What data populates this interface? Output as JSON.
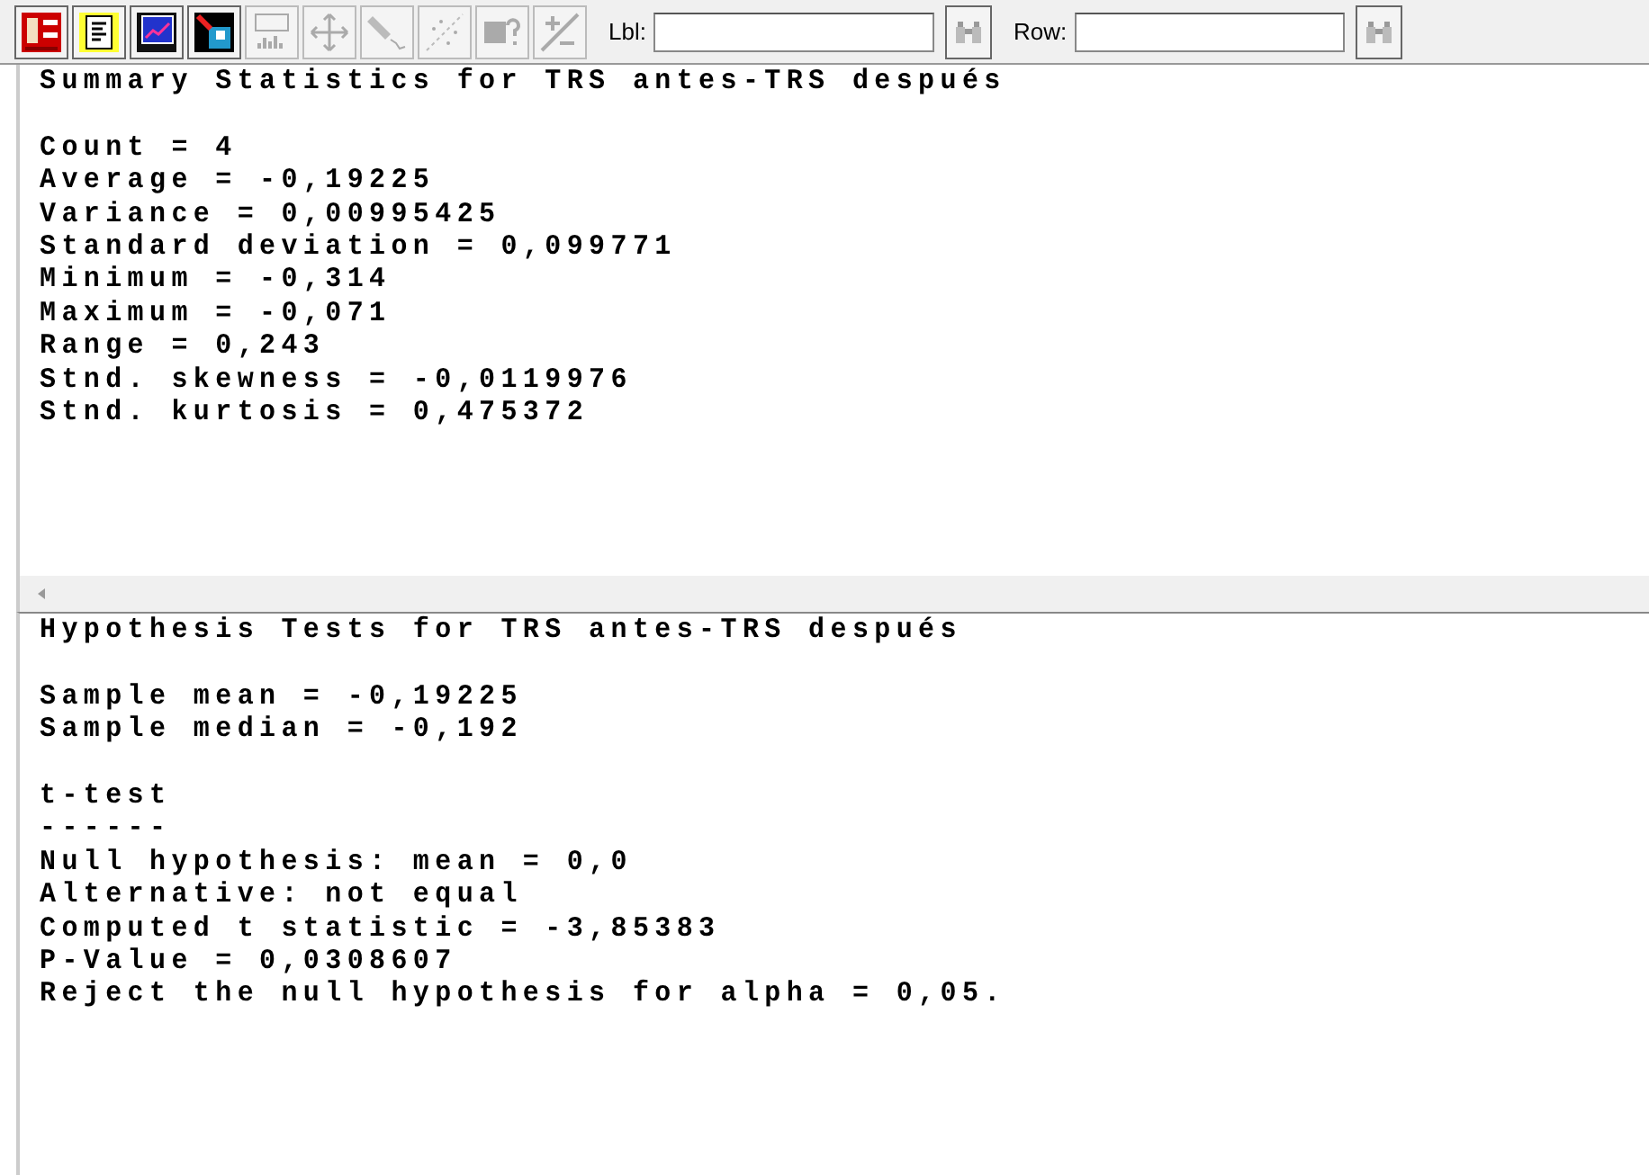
{
  "toolbar": {
    "buttons": [
      {
        "kind": "table",
        "disabled": false
      },
      {
        "kind": "text",
        "disabled": false
      },
      {
        "kind": "graph",
        "disabled": false
      },
      {
        "kind": "save",
        "disabled": false
      },
      {
        "kind": "labels",
        "disabled": true
      },
      {
        "kind": "move",
        "disabled": true
      },
      {
        "kind": "brush",
        "disabled": true
      },
      {
        "kind": "scatter",
        "disabled": true
      },
      {
        "kind": "help",
        "disabled": true
      },
      {
        "kind": "plusminus",
        "disabled": true
      }
    ],
    "label_search": {
      "label": "Lbl:"
    },
    "row_search": {
      "label": "Row:"
    }
  },
  "panes": [
    {
      "blocks": [
        [
          "Summary Statistics for TRS antes-TRS después"
        ],
        [
          "Count = 4",
          "Average = -0,19225",
          "Variance = 0,00995425",
          "Standard deviation = 0,099771",
          "Minimum = -0,314",
          "Maximum = -0,071",
          "Range = 0,243",
          "Stnd. skewness = -0,0119976",
          "Stnd. kurtosis = 0,475372"
        ]
      ]
    },
    {
      "blocks": [
        [
          "Hypothesis Tests for TRS antes-TRS después"
        ],
        [
          "Sample mean = -0,19225",
          "Sample median = -0,192"
        ],
        [
          "t-test",
          "------",
          "Null hypothesis: mean = 0,0",
          "Alternative: not equal",
          "Computed t statistic = -3,85383",
          "P-Value = 0,0308607",
          "Reject the null hypothesis for alpha = 0,05."
        ]
      ]
    }
  ]
}
